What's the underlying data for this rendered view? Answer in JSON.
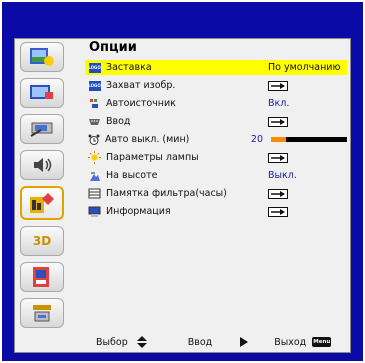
{
  "menu": {
    "title": "Опции",
    "items": [
      {
        "label": "Заставка",
        "value": "По умолчанию",
        "icon": "logo-icon",
        "kind": "text",
        "selected": true
      },
      {
        "label": "Захват изобр.",
        "value": "",
        "icon": "logo-capture-icon",
        "kind": "arrow"
      },
      {
        "label": "Автоисточник",
        "value": "Вкл.",
        "icon": "auto-source-icon",
        "kind": "text"
      },
      {
        "label": "Ввод",
        "value": "",
        "icon": "input-port-icon",
        "kind": "arrow"
      },
      {
        "label": "Авто выкл. (мин)",
        "value": "20",
        "icon": "alarm-clock-icon",
        "kind": "slider",
        "level": 0.2
      },
      {
        "label": "Параметры лампы",
        "value": "",
        "icon": "lamp-icon",
        "kind": "arrow"
      },
      {
        "label": "На высоте",
        "value": "Выкл.",
        "icon": "high-altitude-icon",
        "kind": "text"
      },
      {
        "label": "Памятка фильтра(часы)",
        "value": "",
        "icon": "filter-icon",
        "kind": "arrow"
      },
      {
        "label": "Информация",
        "value": "",
        "icon": "info-icon",
        "kind": "arrow"
      }
    ]
  },
  "sidebar": {
    "items": [
      {
        "name": "picture-icon"
      },
      {
        "name": "display-icon"
      },
      {
        "name": "setup-icon"
      },
      {
        "name": "volume-icon"
      },
      {
        "name": "options-icon",
        "active": true
      },
      {
        "name": "3d-icon",
        "label": "3D"
      },
      {
        "name": "lan-icon"
      },
      {
        "name": "network-icon"
      }
    ]
  },
  "footer": {
    "select": "Выбор",
    "enter": "Ввод",
    "exit": "Выход",
    "menu_key": "Menu"
  },
  "colors": {
    "frame": "#0a0aa6",
    "highlight": "#ffff00",
    "accent": "#ff8c00",
    "active_border": "#e6a000"
  }
}
